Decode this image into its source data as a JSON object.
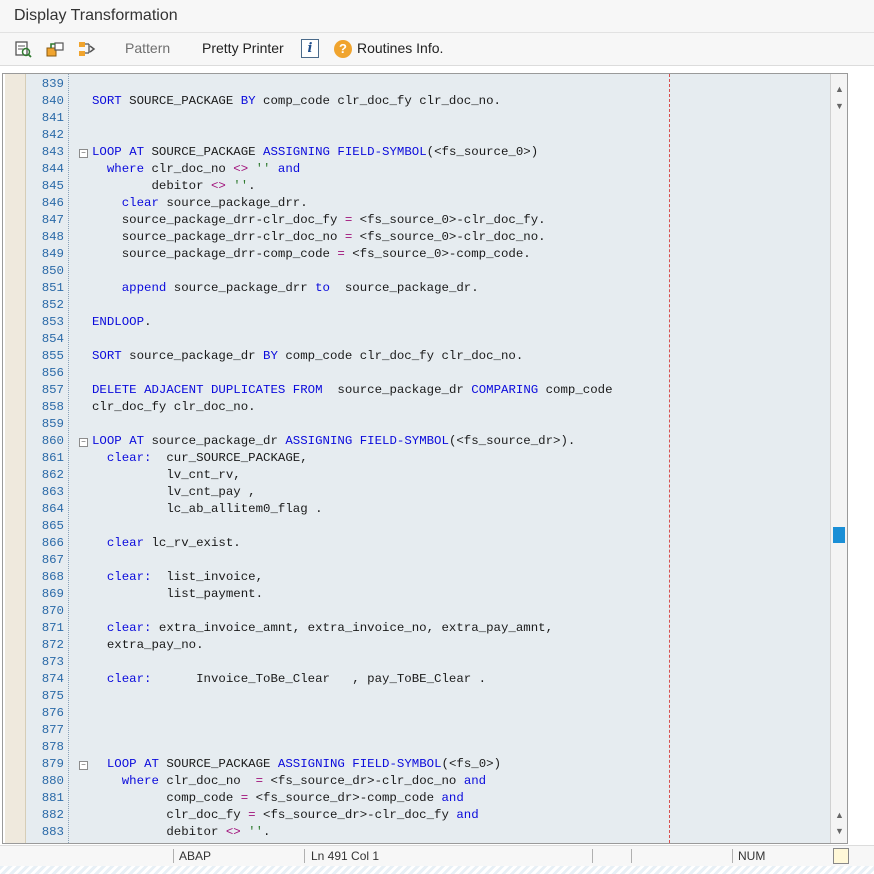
{
  "window": {
    "title": "Display Transformation"
  },
  "toolbar": {
    "pattern_label": "Pattern",
    "pretty_printer_label": "Pretty Printer",
    "info_glyph": "i",
    "routines_info_label": "Routines Info.",
    "icons": [
      "display-change-icon",
      "activate-icon",
      "hierarchy-icon",
      "info-icon",
      "help-icon"
    ]
  },
  "editor": {
    "lines": [
      {
        "num": "839",
        "code": ""
      },
      {
        "num": "840",
        "code": "SORT SOURCE_PACKAGE BY comp_code clr_doc_fy clr_doc_no."
      },
      {
        "num": "841",
        "code": ""
      },
      {
        "num": "842",
        "code": ""
      },
      {
        "num": "843",
        "code": "LOOP AT SOURCE_PACKAGE ASSIGNING FIELD-SYMBOL(<fs_source_0>)",
        "fold": "⊟"
      },
      {
        "num": "844",
        "code": "  where clr_doc_no <> '' and"
      },
      {
        "num": "845",
        "code": "        debitor <> ''."
      },
      {
        "num": "846",
        "code": "    clear source_package_drr."
      },
      {
        "num": "847",
        "code": "    source_package_drr-clr_doc_fy = <fs_source_0>-clr_doc_fy."
      },
      {
        "num": "848",
        "code": "    source_package_drr-clr_doc_no = <fs_source_0>-clr_doc_no."
      },
      {
        "num": "849",
        "code": "    source_package_drr-comp_code = <fs_source_0>-comp_code."
      },
      {
        "num": "850",
        "code": ""
      },
      {
        "num": "851",
        "code": "    append source_package_drr to  source_package_dr."
      },
      {
        "num": "852",
        "code": ""
      },
      {
        "num": "853",
        "code": "ENDLOOP."
      },
      {
        "num": "854",
        "code": ""
      },
      {
        "num": "855",
        "code": "SORT source_package_dr BY comp_code clr_doc_fy clr_doc_no."
      },
      {
        "num": "856",
        "code": ""
      },
      {
        "num": "857",
        "code": "DELETE ADJACENT DUPLICATES FROM  source_package_dr COMPARING comp_code"
      },
      {
        "num": "858",
        "code": "clr_doc_fy clr_doc_no."
      },
      {
        "num": "859",
        "code": ""
      },
      {
        "num": "860",
        "code": "LOOP AT source_package_dr ASSIGNING FIELD-SYMBOL(<fs_source_dr>).",
        "fold": "⊟"
      },
      {
        "num": "861",
        "code": "  clear:  cur_SOURCE_PACKAGE,"
      },
      {
        "num": "862",
        "code": "          lv_cnt_rv,"
      },
      {
        "num": "863",
        "code": "          lv_cnt_pay ,"
      },
      {
        "num": "864",
        "code": "          lc_ab_allitem0_flag ."
      },
      {
        "num": "865",
        "code": ""
      },
      {
        "num": "866",
        "code": "  clear lc_rv_exist."
      },
      {
        "num": "867",
        "code": ""
      },
      {
        "num": "868",
        "code": "  clear:  list_invoice,"
      },
      {
        "num": "869",
        "code": "          list_payment."
      },
      {
        "num": "870",
        "code": ""
      },
      {
        "num": "871",
        "code": "  clear: extra_invoice_amnt, extra_invoice_no, extra_pay_amnt,"
      },
      {
        "num": "872",
        "code": "  extra_pay_no."
      },
      {
        "num": "873",
        "code": ""
      },
      {
        "num": "874",
        "code": "  clear:      Invoice_ToBe_Clear   , pay_ToBE_Clear ."
      },
      {
        "num": "875",
        "code": ""
      },
      {
        "num": "876",
        "code": ""
      },
      {
        "num": "877",
        "code": ""
      },
      {
        "num": "878",
        "code": ""
      },
      {
        "num": "879",
        "code": "  LOOP AT SOURCE_PACKAGE ASSIGNING FIELD-SYMBOL(<fs_0>)",
        "fold": "⊟"
      },
      {
        "num": "880",
        "code": "    where clr_doc_no  = <fs_source_dr>-clr_doc_no and"
      },
      {
        "num": "881",
        "code": "          comp_code = <fs_source_dr>-comp_code and"
      },
      {
        "num": "882",
        "code": "          clr_doc_fy = <fs_source_dr>-clr_doc_fy and"
      },
      {
        "num": "883",
        "code": "          debitor <> ''."
      }
    ]
  },
  "status": {
    "language": "ABAP",
    "position": "Ln 491 Col   1",
    "num_lock": "NUM"
  },
  "colors": {
    "keyword": "#0a0adc",
    "operator": "#a0107a",
    "string": "#2f7a2f",
    "line_number": "#2b6aa8",
    "editor_bg": "#e6ecf0",
    "scroll_thumb": "#1b8fd6"
  }
}
